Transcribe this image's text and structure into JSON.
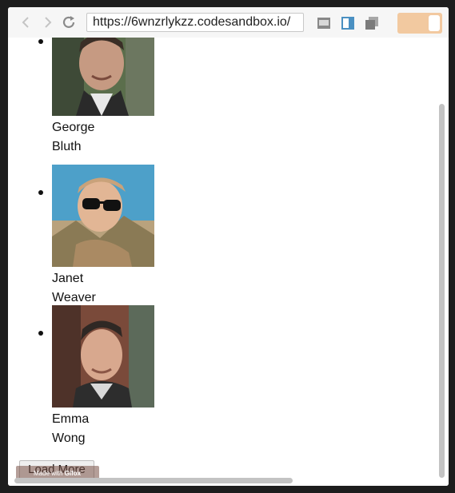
{
  "browser": {
    "url": "https://6wnzrlykzz.codesandbox.io/",
    "back_icon": "chevron-left-icon",
    "forward_icon": "chevron-right-icon",
    "reload_icon": "reload-icon",
    "toolbar_icons": [
      "reader-view-icon",
      "sidebar-icon",
      "tabs-overview-icon"
    ],
    "toggle": {
      "state": "on",
      "accent": "#f2c9a0"
    }
  },
  "users": [
    {
      "first_name": "George",
      "last_name": "Bluth"
    },
    {
      "first_name": "Janet",
      "last_name": "Weaver"
    },
    {
      "first_name": "Emma",
      "last_name": "Wong"
    }
  ],
  "load_more_label": "Load More",
  "watermark": {
    "prefix": "Made with",
    "brand": "Gifox"
  }
}
